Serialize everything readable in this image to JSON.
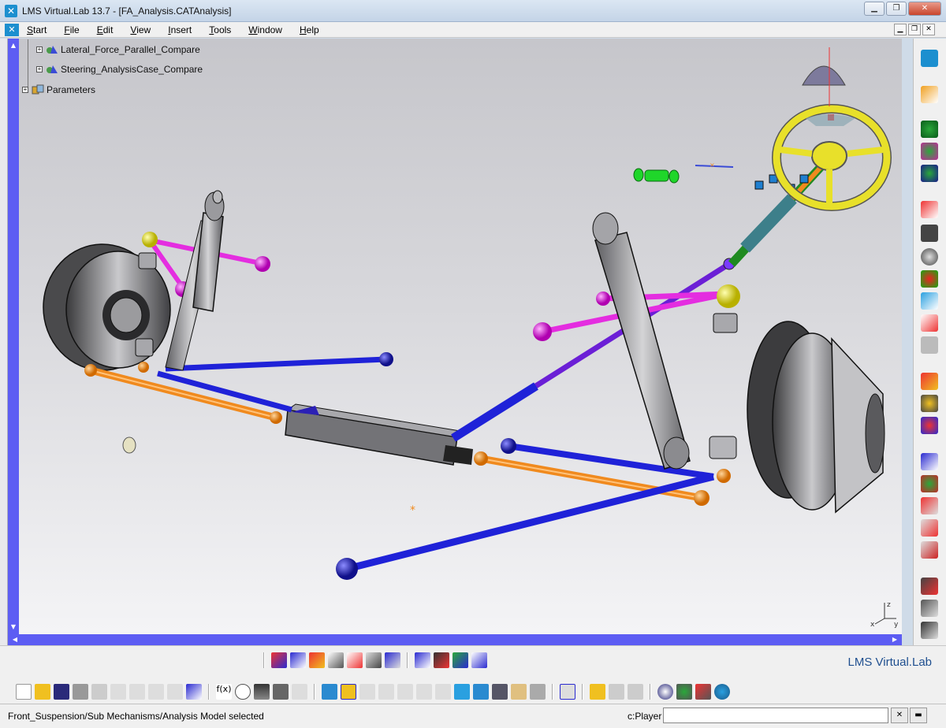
{
  "window": {
    "title": "LMS Virtual.Lab 13.7 - [FA_Analysis.CATAnalysis]",
    "app_icon": "lms-app-icon",
    "controls": [
      "minimize",
      "restore",
      "close"
    ]
  },
  "menu": {
    "items": [
      "Start",
      "File",
      "Edit",
      "View",
      "Insert",
      "Tools",
      "Window",
      "Help"
    ]
  },
  "tree": {
    "items": [
      {
        "label": "Lateral_Force_Parallel_Compare",
        "icon": "analysis-case-icon"
      },
      {
        "label": "Steering_AnalysisCase_Compare",
        "icon": "analysis-case-icon"
      },
      {
        "label": "Parameters",
        "icon": "parameters-icon"
      }
    ]
  },
  "brand": {
    "name": "LMS Virtual.Lab"
  },
  "status": {
    "message": "Front_Suspension/Sub Mechanisms/Analysis Model selected",
    "command_label": "c:Player",
    "command_value": ""
  },
  "colors": {
    "tie_rod": "#f08a1e",
    "control_arm": "#1f22d8",
    "upper_arm": "#e42de0",
    "steering_link": "#6b1fd6",
    "steering_wheel": "#e8e02a",
    "shock": "#8e8e92",
    "scrollbar": "#5d5df3"
  }
}
